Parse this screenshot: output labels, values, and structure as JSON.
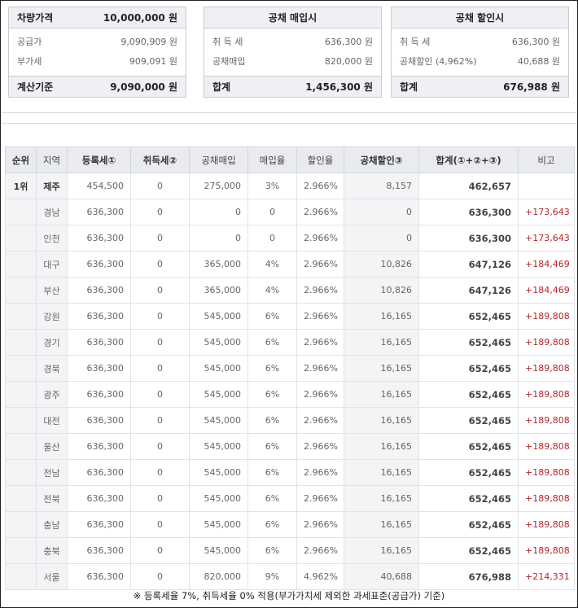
{
  "box1": {
    "header_label": "차량가격",
    "header_value": "10,000,000 원",
    "rows": [
      {
        "label": "공급가",
        "value": "9,090,909 원"
      },
      {
        "label": "부가세",
        "value": "909,091 원"
      }
    ],
    "footer_label": "계산기준",
    "footer_value": "9,090,000 원"
  },
  "box2": {
    "header": "공채 매입시",
    "rows": [
      {
        "label": "취 득 세",
        "value": "636,300 원"
      },
      {
        "label": "공채매입",
        "value": "820,000 원"
      }
    ],
    "footer_label": "합계",
    "footer_value": "1,456,300 원"
  },
  "box3": {
    "header": "공채 할인시",
    "rows": [
      {
        "label": "취 득 세",
        "value": "636,300 원"
      },
      {
        "label": "공채할인 (4,962%)",
        "value": "40,688 원"
      }
    ],
    "footer_label": "합계",
    "footer_value": "676,988 원"
  },
  "table": {
    "headers": [
      "순위",
      "지역",
      "등록세①",
      "취득세②",
      "공채매입",
      "매입율",
      "할인율",
      "공채할인③",
      "합계(①+②+③)",
      "비고"
    ],
    "rows": [
      {
        "rank": "1위",
        "region": "제주",
        "reg_tax": "454,500",
        "acq_tax": "0",
        "bond": "275,000",
        "buy_rate": "3%",
        "disc_rate": "2.966%",
        "bond_disc": "8,157",
        "total": "462,657",
        "note": ""
      },
      {
        "rank": "",
        "region": "경남",
        "reg_tax": "636,300",
        "acq_tax": "0",
        "bond": "0",
        "buy_rate": "0",
        "disc_rate": "2.966%",
        "bond_disc": "0",
        "total": "636,300",
        "note": "+173,643"
      },
      {
        "rank": "",
        "region": "인천",
        "reg_tax": "636,300",
        "acq_tax": "0",
        "bond": "0",
        "buy_rate": "0",
        "disc_rate": "2.966%",
        "bond_disc": "0",
        "total": "636,300",
        "note": "+173,643"
      },
      {
        "rank": "",
        "region": "대구",
        "reg_tax": "636,300",
        "acq_tax": "0",
        "bond": "365,000",
        "buy_rate": "4%",
        "disc_rate": "2.966%",
        "bond_disc": "10,826",
        "total": "647,126",
        "note": "+184,469"
      },
      {
        "rank": "",
        "region": "부산",
        "reg_tax": "636,300",
        "acq_tax": "0",
        "bond": "365,000",
        "buy_rate": "4%",
        "disc_rate": "2.966%",
        "bond_disc": "10,826",
        "total": "647,126",
        "note": "+184,469"
      },
      {
        "rank": "",
        "region": "강원",
        "reg_tax": "636,300",
        "acq_tax": "0",
        "bond": "545,000",
        "buy_rate": "6%",
        "disc_rate": "2.966%",
        "bond_disc": "16,165",
        "total": "652,465",
        "note": "+189,808"
      },
      {
        "rank": "",
        "region": "경기",
        "reg_tax": "636,300",
        "acq_tax": "0",
        "bond": "545,000",
        "buy_rate": "6%",
        "disc_rate": "2.966%",
        "bond_disc": "16,165",
        "total": "652,465",
        "note": "+189,808"
      },
      {
        "rank": "",
        "region": "경북",
        "reg_tax": "636,300",
        "acq_tax": "0",
        "bond": "545,000",
        "buy_rate": "6%",
        "disc_rate": "2.966%",
        "bond_disc": "16,165",
        "total": "652,465",
        "note": "+189,808"
      },
      {
        "rank": "",
        "region": "광주",
        "reg_tax": "636,300",
        "acq_tax": "0",
        "bond": "545,000",
        "buy_rate": "6%",
        "disc_rate": "2.966%",
        "bond_disc": "16,165",
        "total": "652,465",
        "note": "+189,808"
      },
      {
        "rank": "",
        "region": "대전",
        "reg_tax": "636,300",
        "acq_tax": "0",
        "bond": "545,000",
        "buy_rate": "6%",
        "disc_rate": "2.966%",
        "bond_disc": "16,165",
        "total": "652,465",
        "note": "+189,808"
      },
      {
        "rank": "",
        "region": "울산",
        "reg_tax": "636,300",
        "acq_tax": "0",
        "bond": "545,000",
        "buy_rate": "6%",
        "disc_rate": "2.966%",
        "bond_disc": "16,165",
        "total": "652,465",
        "note": "+189,808"
      },
      {
        "rank": "",
        "region": "전남",
        "reg_tax": "636,300",
        "acq_tax": "0",
        "bond": "545,000",
        "buy_rate": "6%",
        "disc_rate": "2.966%",
        "bond_disc": "16,165",
        "total": "652,465",
        "note": "+189,808"
      },
      {
        "rank": "",
        "region": "전북",
        "reg_tax": "636,300",
        "acq_tax": "0",
        "bond": "545,000",
        "buy_rate": "6%",
        "disc_rate": "2.966%",
        "bond_disc": "16,165",
        "total": "652,465",
        "note": "+189,808"
      },
      {
        "rank": "",
        "region": "충남",
        "reg_tax": "636,300",
        "acq_tax": "0",
        "bond": "545,000",
        "buy_rate": "6%",
        "disc_rate": "2.966%",
        "bond_disc": "16,165",
        "total": "652,465",
        "note": "+189,808"
      },
      {
        "rank": "",
        "region": "충북",
        "reg_tax": "636,300",
        "acq_tax": "0",
        "bond": "545,000",
        "buy_rate": "6%",
        "disc_rate": "2.966%",
        "bond_disc": "16,165",
        "total": "652,465",
        "note": "+189,808"
      },
      {
        "rank": "",
        "region": "서울",
        "reg_tax": "636,300",
        "acq_tax": "0",
        "bond": "820,000",
        "buy_rate": "9%",
        "disc_rate": "4.962%",
        "bond_disc": "40,688",
        "total": "676,988",
        "note": "+214,331"
      }
    ]
  },
  "footnote": "※ 등록세율 7%, 취득세율 0% 적용(부가가치세 제외한 과세표준(공급가) 기준)"
}
